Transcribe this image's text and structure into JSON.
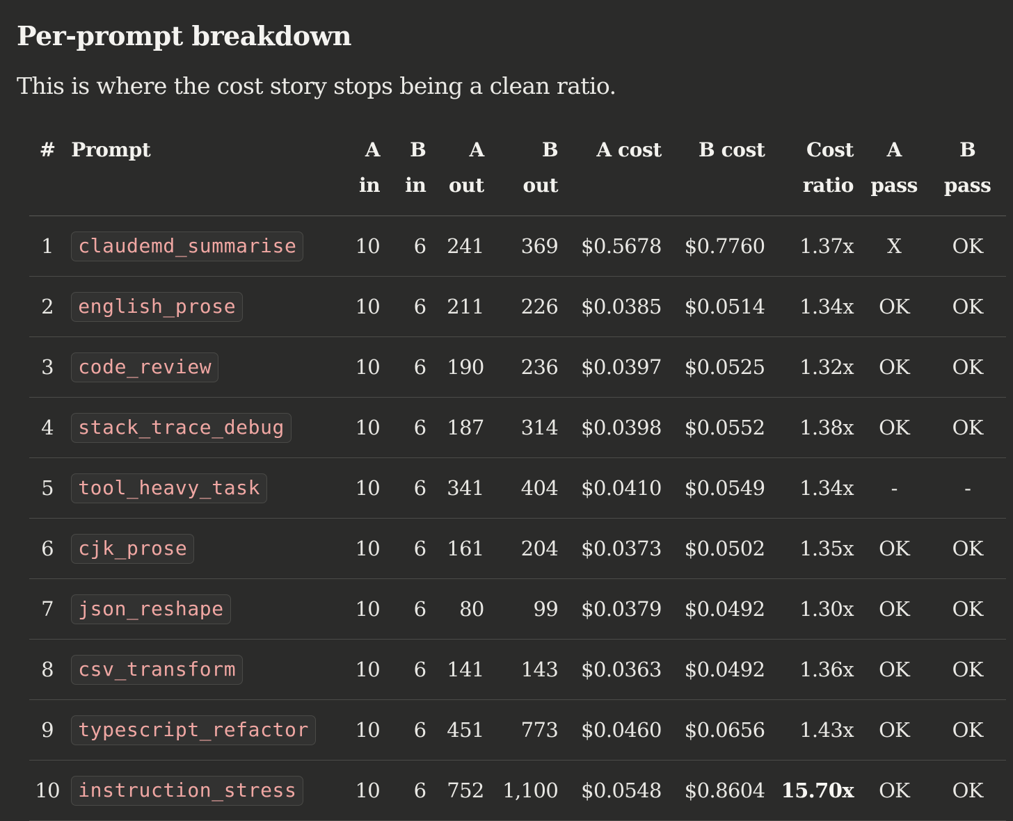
{
  "heading": "Per-prompt breakdown",
  "subtitle": "This is where the cost story stops being a clean ratio.",
  "table": {
    "headers": {
      "num": "#",
      "prompt": "Prompt",
      "a_in_1": "A",
      "a_in_2": "in",
      "b_in_1": "B",
      "b_in_2": "in",
      "a_out_1": "A",
      "a_out_2": "out",
      "b_out_1": "B",
      "b_out_2": "out",
      "a_cost": "A cost",
      "b_cost": "B cost",
      "ratio_1": "Cost",
      "ratio_2": "ratio",
      "a_pass_1": "A",
      "a_pass_2": "pass",
      "b_pass_1": "B",
      "b_pass_2": "pass"
    },
    "rows": [
      {
        "num": "1",
        "prompt": "claudemd_summarise",
        "a_in": "10",
        "b_in": "6",
        "a_out": "241",
        "b_out": "369",
        "a_cost": "$0.5678",
        "b_cost": "$0.7760",
        "ratio": "1.37x",
        "a_pass": "X",
        "b_pass": "OK"
      },
      {
        "num": "2",
        "prompt": "english_prose",
        "a_in": "10",
        "b_in": "6",
        "a_out": "211",
        "b_out": "226",
        "a_cost": "$0.0385",
        "b_cost": "$0.0514",
        "ratio": "1.34x",
        "a_pass": "OK",
        "b_pass": "OK"
      },
      {
        "num": "3",
        "prompt": "code_review",
        "a_in": "10",
        "b_in": "6",
        "a_out": "190",
        "b_out": "236",
        "a_cost": "$0.0397",
        "b_cost": "$0.0525",
        "ratio": "1.32x",
        "a_pass": "OK",
        "b_pass": "OK"
      },
      {
        "num": "4",
        "prompt": "stack_trace_debug",
        "a_in": "10",
        "b_in": "6",
        "a_out": "187",
        "b_out": "314",
        "a_cost": "$0.0398",
        "b_cost": "$0.0552",
        "ratio": "1.38x",
        "a_pass": "OK",
        "b_pass": "OK"
      },
      {
        "num": "5",
        "prompt": "tool_heavy_task",
        "a_in": "10",
        "b_in": "6",
        "a_out": "341",
        "b_out": "404",
        "a_cost": "$0.0410",
        "b_cost": "$0.0549",
        "ratio": "1.34x",
        "a_pass": "-",
        "b_pass": "-"
      },
      {
        "num": "6",
        "prompt": "cjk_prose",
        "a_in": "10",
        "b_in": "6",
        "a_out": "161",
        "b_out": "204",
        "a_cost": "$0.0373",
        "b_cost": "$0.0502",
        "ratio": "1.35x",
        "a_pass": "OK",
        "b_pass": "OK"
      },
      {
        "num": "7",
        "prompt": "json_reshape",
        "a_in": "10",
        "b_in": "6",
        "a_out": "80",
        "b_out": "99",
        "a_cost": "$0.0379",
        "b_cost": "$0.0492",
        "ratio": "1.30x",
        "a_pass": "OK",
        "b_pass": "OK"
      },
      {
        "num": "8",
        "prompt": "csv_transform",
        "a_in": "10",
        "b_in": "6",
        "a_out": "141",
        "b_out": "143",
        "a_cost": "$0.0363",
        "b_cost": "$0.0492",
        "ratio": "1.36x",
        "a_pass": "OK",
        "b_pass": "OK"
      },
      {
        "num": "9",
        "prompt": "typescript_refactor",
        "a_in": "10",
        "b_in": "6",
        "a_out": "451",
        "b_out": "773",
        "a_cost": "$0.0460",
        "b_cost": "$0.0656",
        "ratio": "1.43x",
        "a_pass": "OK",
        "b_pass": "OK"
      },
      {
        "num": "10",
        "prompt": "instruction_stress",
        "a_in": "10",
        "b_in": "6",
        "a_out": "752",
        "b_out": "1,100",
        "a_cost": "$0.0548",
        "b_cost": "$0.8604",
        "ratio": "15.70x",
        "ratio_bold": true,
        "a_pass": "OK",
        "b_pass": "OK"
      }
    ]
  }
}
